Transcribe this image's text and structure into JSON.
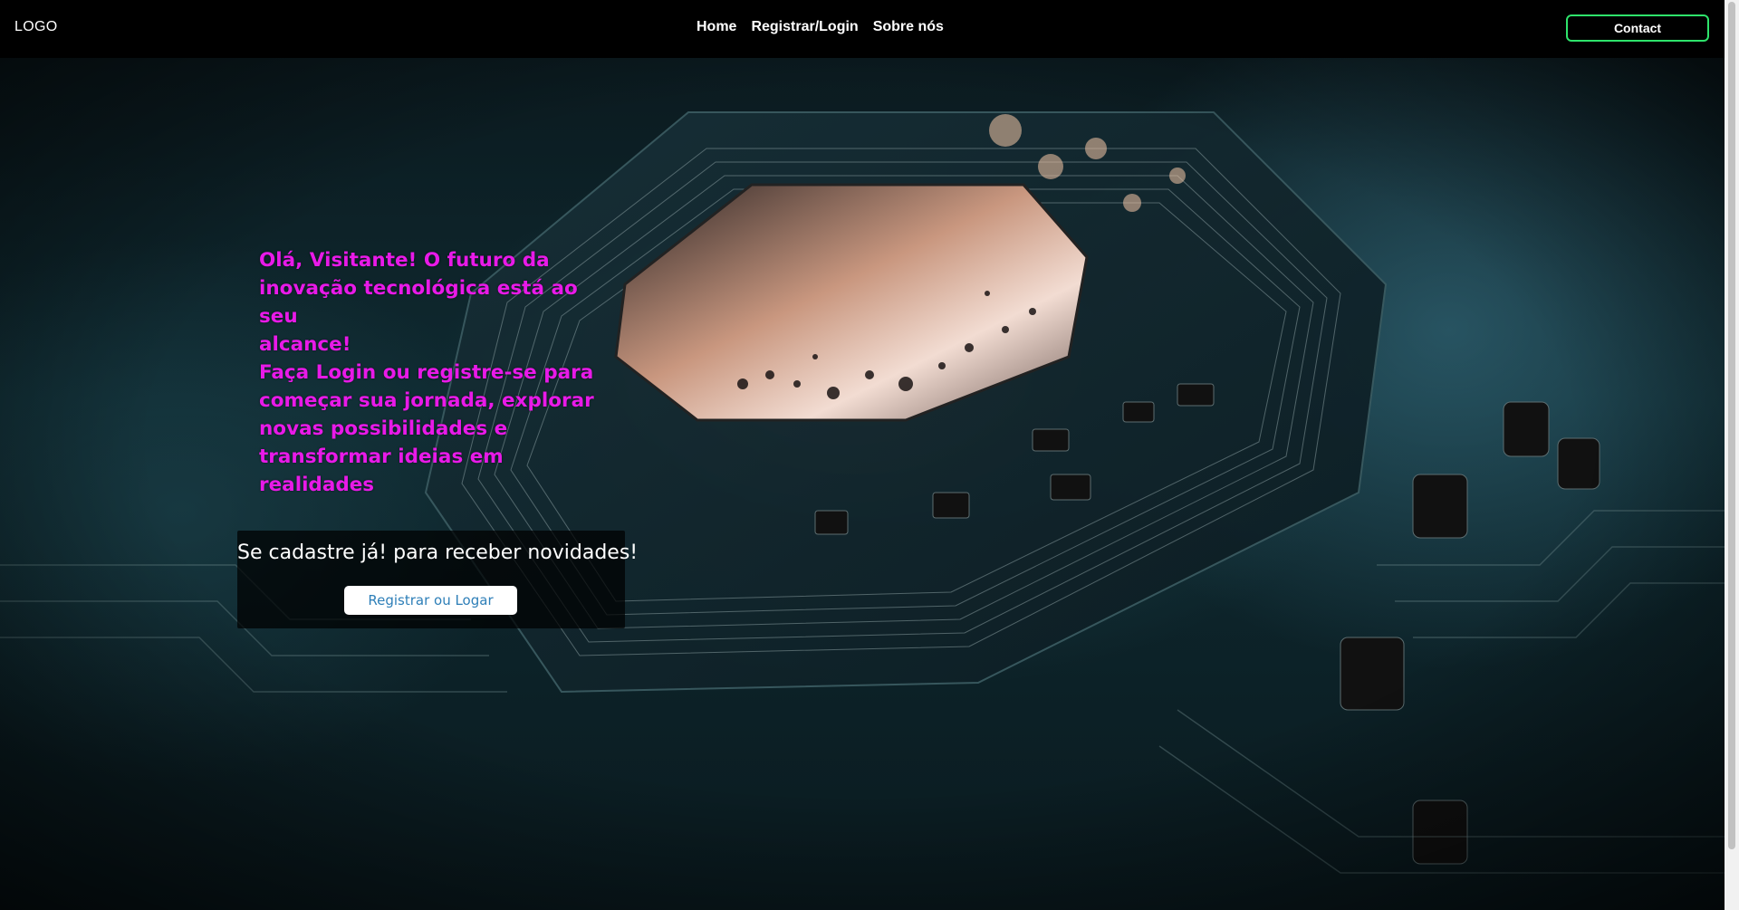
{
  "header": {
    "logo": "LOGO",
    "nav": [
      {
        "label": "Home"
      },
      {
        "label": "Registrar/Login"
      },
      {
        "label": "Sobre nós"
      }
    ],
    "contact_label": "Contact"
  },
  "hero": {
    "headline": [
      "Olá, Visitante! O futuro da",
      "inovação tecnológica está ao seu",
      "alcance!",
      "Faça Login ou registre-se para",
      "começar sua jornada, explorar",
      "novas possibilidades e",
      "transformar ideias em realidades"
    ],
    "signup_text": "Se cadastre já! para receber novidades!",
    "signup_button": "Registrar ou Logar"
  },
  "colors": {
    "headline": "#e81ae8",
    "contact_border": "#2ee36b",
    "button_text": "#2e7fb8"
  }
}
